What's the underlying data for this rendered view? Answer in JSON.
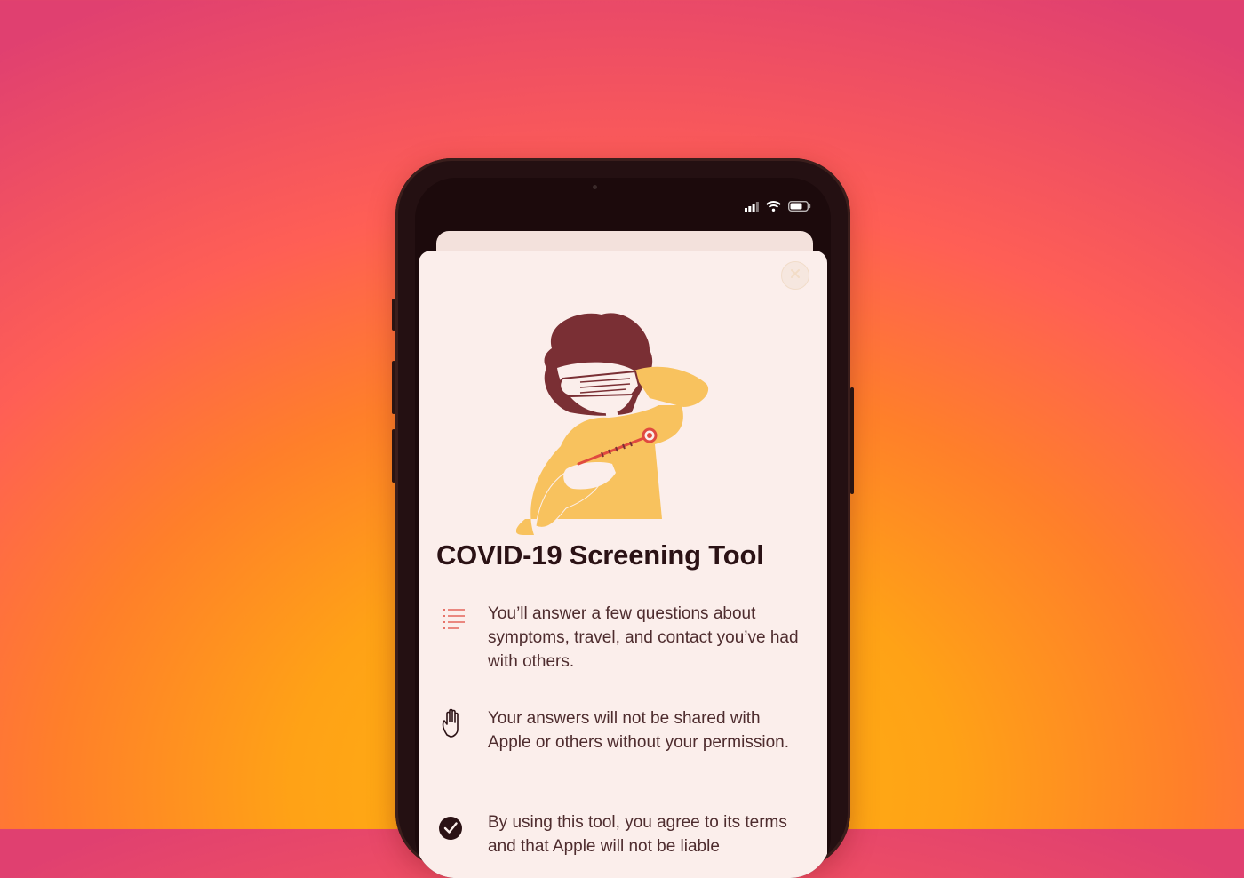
{
  "status_bar": {
    "icons": [
      "signal-bars-icon",
      "wifi-icon",
      "battery-icon"
    ]
  },
  "sheet": {
    "close_icon": "close-icon",
    "illustration": "person-with-thermometer-illustration",
    "title": "COVID-19 Screening Tool",
    "items": [
      {
        "icon": "checklist-icon",
        "text": "You’ll answer a few questions about symptoms, travel, and contact you’ve had with others."
      },
      {
        "icon": "raised-hand-icon",
        "text": "Your answers will not be shared with Apple or others without your permission."
      },
      {
        "icon": "checkmark-circle-icon",
        "text": "By using this tool, you agree to its terms and that Apple will not be liable"
      }
    ]
  },
  "colors": {
    "background_top": "#e04070",
    "background_bottom": "#ffb510",
    "sheet": "#fbeeeb",
    "title_text": "#2b1215",
    "body_text": "#4e2c2e",
    "accent": "#e04a3f",
    "illustration_yellow": "#f8c25e",
    "hair": "#7a2f34"
  }
}
